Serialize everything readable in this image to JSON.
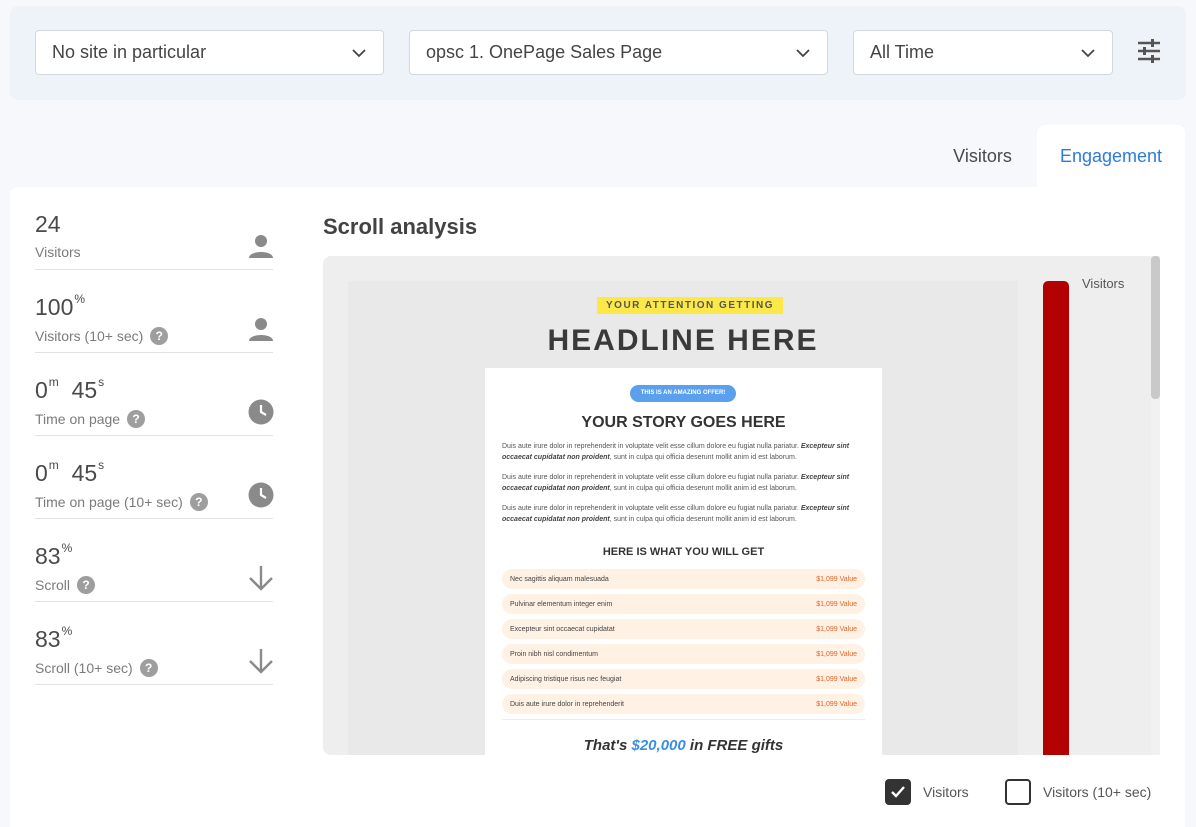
{
  "filters": {
    "site": "No site in particular",
    "page": "opsc 1. OnePage Sales Page",
    "range": "All Time",
    "settings_icon": "tune-icon"
  },
  "tabs": [
    {
      "label": "Visitors",
      "active": false
    },
    {
      "label": "Engagement",
      "active": true
    }
  ],
  "stats": [
    {
      "value": "24",
      "unit": "",
      "value2": "",
      "unit2": "",
      "label": "Visitors",
      "help": false,
      "icon": "person-icon"
    },
    {
      "value": "100",
      "unit": "%",
      "value2": "",
      "unit2": "",
      "label": "Visitors (10+ sec)",
      "help": true,
      "icon": "person-icon"
    },
    {
      "value": "0",
      "unit": "m",
      "value2": "45",
      "unit2": "s",
      "label": "Time on page",
      "help": true,
      "icon": "clock-icon"
    },
    {
      "value": "0",
      "unit": "m",
      "value2": "45",
      "unit2": "s",
      "label": "Time on page (10+ sec)",
      "help": true,
      "icon": "clock-icon"
    },
    {
      "value": "83",
      "unit": "%",
      "value2": "",
      "unit2": "",
      "label": "Scroll",
      "help": true,
      "icon": "arrow-down-icon"
    },
    {
      "value": "83",
      "unit": "%",
      "value2": "",
      "unit2": "",
      "label": "Scroll (10+ sec)",
      "help": true,
      "icon": "arrow-down-icon"
    }
  ],
  "help_glyph": "?",
  "scroll_analysis": {
    "title": "Scroll analysis",
    "legend_label": "Visitors",
    "bar_color": "#b30000",
    "preview": {
      "banner": "YOUR ATTENTION GETTING",
      "headline": "HEADLINE HERE",
      "pill": "THIS IS AN AMAZING OFFER!",
      "story_title": "YOUR STORY GOES HERE",
      "paragraph_text": "Duis aute irure dolor in reprehenderit in voluptate velit esse cillum dolore eu fugiat nulla pariatur. ",
      "paragraph_bold": "Excepteur sint occaecat cupidatat non proident",
      "paragraph_tail": ", sunt in culpa qui officia deserunt mollit anim id est laborum.",
      "benefits_title": "HERE IS WHAT YOU WILL GET",
      "benefits": [
        {
          "name": "Nec sagittis aliquam malesuada",
          "price": "$1,099 Value"
        },
        {
          "name": "Pulvinar elementum integer enim",
          "price": "$1,099 Value"
        },
        {
          "name": "Excepteur sint occaecat cupidatat",
          "price": "$1,099 Value"
        },
        {
          "name": "Proin nibh nisl condimentum",
          "price": "$1,099 Value"
        },
        {
          "name": "Adipiscing tristique risus nec feugiat",
          "price": "$1,099 Value"
        },
        {
          "name": "Duis aute irure dolor in reprehenderit",
          "price": "$1,099 Value"
        }
      ],
      "gifts_prefix": "That's ",
      "gifts_amount": "$20,000",
      "gifts_suffix": " in FREE gifts"
    }
  },
  "checkboxes": [
    {
      "label": "Visitors",
      "checked": true
    },
    {
      "label": "Visitors (10+ sec)",
      "checked": false
    }
  ],
  "colors": {
    "accent": "#2d7bd8",
    "bar": "#b30000",
    "highlight": "#fde84a"
  }
}
